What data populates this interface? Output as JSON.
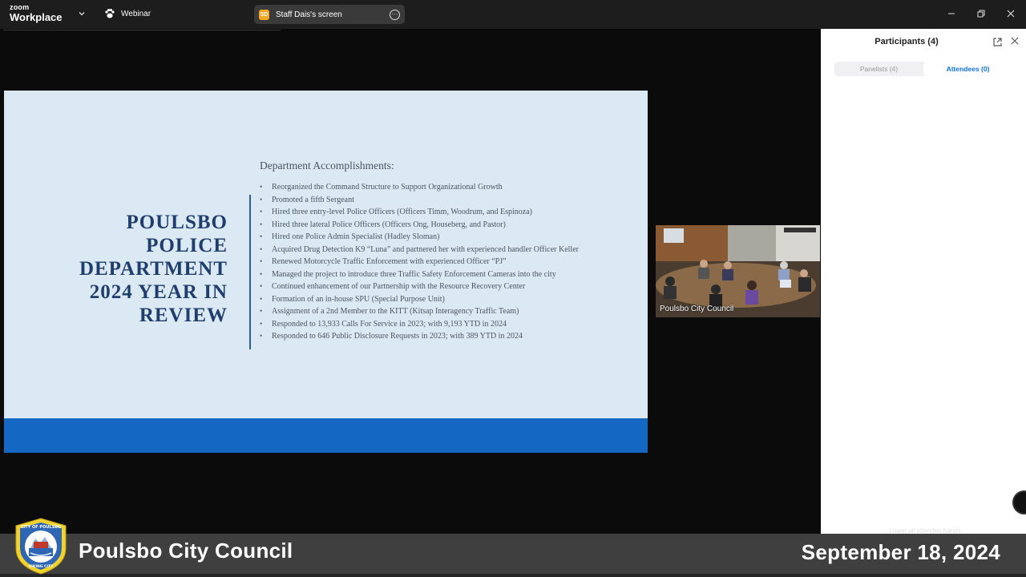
{
  "titlebar": {
    "brand_top": "zoom",
    "brand_bottom": "Workplace",
    "mode_label": "Webinar",
    "share_badge": "SD",
    "share_label": "Staff Dais's screen"
  },
  "slide": {
    "title_lines": [
      "POULSBO",
      "POLICE",
      "DEPARTMENT",
      "2024 YEAR IN",
      "REVIEW"
    ],
    "heading": "Department Accomplishments:",
    "items": [
      "Reorganized the Command Structure to Support Organizational Growth",
      "Promoted a fifth Sergeant",
      "Hired three entry-level Police Officers (Officers Timm, Woodrum, and Espinoza)",
      "Hired three lateral Police Officers (Officers Ong, Houseberg, and Pastor)",
      "Hired one Police Admin Specialist (Hadley Sloman)",
      "Acquired Drug Detection K9 “Luna” and partnered her with experienced handler Officer Keller",
      "Renewed Motorcycle Traffic Enforcement with experienced Officer “PJ”",
      "Managed the project to introduce three Traffic Safety Enforcement Cameras into the city",
      "Continued enhancement of our Partnership with the Resource Recovery Center",
      "Formation of an in-house SPU (Special Purpose Unit)",
      "Assignment of a 2nd Member to the KITT (Kitsap Interagency Traffic Team)",
      "Responded to 13,933 Calls For Service in 2023; with 9,193 YTD in 2024",
      "Responded to 646 Public Disclosure Requests in 2023; with 389 YTD in 2024"
    ],
    "colors": {
      "background": "#dbe9f5",
      "footer": "#1468c4",
      "title": "#1f3e6e"
    }
  },
  "video": {
    "label": "Poulsbo City Council"
  },
  "panel": {
    "title": "Participants (4)",
    "tabs": [
      {
        "label": "Panelists (4)",
        "active": false
      },
      {
        "label": "Attendees (0)",
        "active": true
      }
    ],
    "faded_text": "Lower all attendee hands"
  },
  "banner": {
    "name": "Poulsbo City Council",
    "date": "September 18, 2024",
    "seal_text_top": "CITY OF POULSBO",
    "seal_text_bottom": "VIKING CITY"
  }
}
